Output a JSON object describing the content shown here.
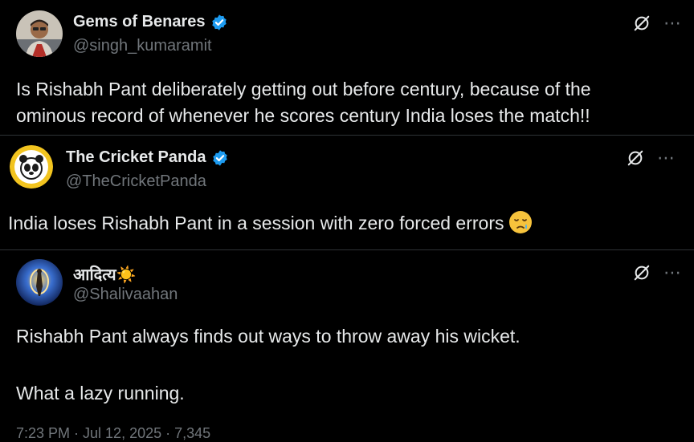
{
  "tweets": [
    {
      "name": "Gems of Benares",
      "handle": "@singh_kumaramit",
      "verified": true,
      "avatar": "person-photo",
      "text_lines": [
        "Is Rishabh Pant deliberately getting out before century, because of the",
        "ominous record of whenever he scores century India loses the match!!"
      ]
    },
    {
      "name": "The Cricket Panda",
      "handle": "@TheCricketPanda",
      "verified": true,
      "avatar": "panda-logo",
      "text_lines": [
        "India loses Rishabh Pant in a session with zero forced errors"
      ],
      "emoji": "sad-relieved-face-emoji"
    },
    {
      "name": "आदित्य☀️",
      "handle": "@Shalivaahan",
      "verified": false,
      "avatar": "figure-art",
      "text_lines": [
        "Rishabh Pant always finds out ways to throw away his wicket.",
        "What a lazy running."
      ],
      "footer": "7:23 PM · Jul 12, 2025 · 7,345"
    }
  ],
  "icons": {
    "more": "⋯",
    "grok": "grok-icon",
    "verified": "verified-badge-icon"
  },
  "colors": {
    "background": "#000000",
    "text": "#e7e9ea",
    "muted": "#71767b",
    "verified": "#1d9bf0",
    "divider": "#2f3336"
  }
}
